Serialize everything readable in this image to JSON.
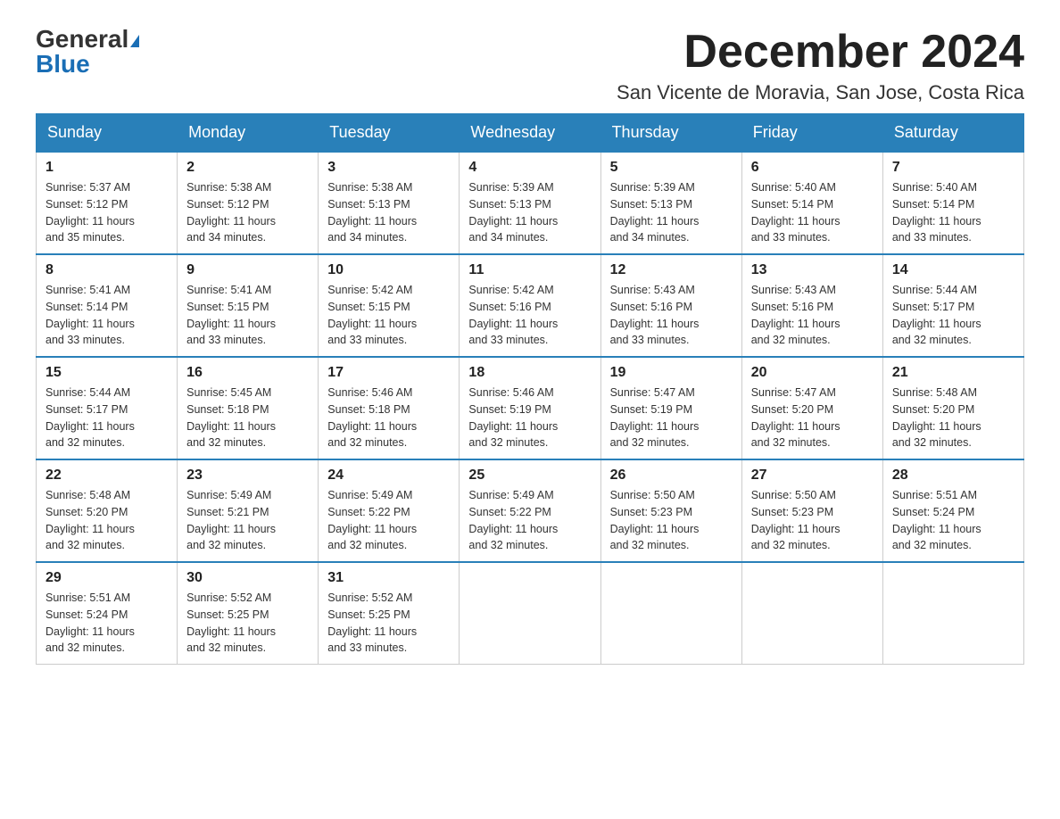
{
  "logo": {
    "general": "General",
    "blue": "Blue"
  },
  "header": {
    "month_year": "December 2024",
    "location": "San Vicente de Moravia, San Jose, Costa Rica"
  },
  "days_of_week": [
    "Sunday",
    "Monday",
    "Tuesday",
    "Wednesday",
    "Thursday",
    "Friday",
    "Saturday"
  ],
  "weeks": [
    [
      {
        "day": "1",
        "sunrise": "5:37 AM",
        "sunset": "5:12 PM",
        "daylight": "11 hours and 35 minutes."
      },
      {
        "day": "2",
        "sunrise": "5:38 AM",
        "sunset": "5:12 PM",
        "daylight": "11 hours and 34 minutes."
      },
      {
        "day": "3",
        "sunrise": "5:38 AM",
        "sunset": "5:13 PM",
        "daylight": "11 hours and 34 minutes."
      },
      {
        "day": "4",
        "sunrise": "5:39 AM",
        "sunset": "5:13 PM",
        "daylight": "11 hours and 34 minutes."
      },
      {
        "day": "5",
        "sunrise": "5:39 AM",
        "sunset": "5:13 PM",
        "daylight": "11 hours and 34 minutes."
      },
      {
        "day": "6",
        "sunrise": "5:40 AM",
        "sunset": "5:14 PM",
        "daylight": "11 hours and 33 minutes."
      },
      {
        "day": "7",
        "sunrise": "5:40 AM",
        "sunset": "5:14 PM",
        "daylight": "11 hours and 33 minutes."
      }
    ],
    [
      {
        "day": "8",
        "sunrise": "5:41 AM",
        "sunset": "5:14 PM",
        "daylight": "11 hours and 33 minutes."
      },
      {
        "day": "9",
        "sunrise": "5:41 AM",
        "sunset": "5:15 PM",
        "daylight": "11 hours and 33 minutes."
      },
      {
        "day": "10",
        "sunrise": "5:42 AM",
        "sunset": "5:15 PM",
        "daylight": "11 hours and 33 minutes."
      },
      {
        "day": "11",
        "sunrise": "5:42 AM",
        "sunset": "5:16 PM",
        "daylight": "11 hours and 33 minutes."
      },
      {
        "day": "12",
        "sunrise": "5:43 AM",
        "sunset": "5:16 PM",
        "daylight": "11 hours and 33 minutes."
      },
      {
        "day": "13",
        "sunrise": "5:43 AM",
        "sunset": "5:16 PM",
        "daylight": "11 hours and 32 minutes."
      },
      {
        "day": "14",
        "sunrise": "5:44 AM",
        "sunset": "5:17 PM",
        "daylight": "11 hours and 32 minutes."
      }
    ],
    [
      {
        "day": "15",
        "sunrise": "5:44 AM",
        "sunset": "5:17 PM",
        "daylight": "11 hours and 32 minutes."
      },
      {
        "day": "16",
        "sunrise": "5:45 AM",
        "sunset": "5:18 PM",
        "daylight": "11 hours and 32 minutes."
      },
      {
        "day": "17",
        "sunrise": "5:46 AM",
        "sunset": "5:18 PM",
        "daylight": "11 hours and 32 minutes."
      },
      {
        "day": "18",
        "sunrise": "5:46 AM",
        "sunset": "5:19 PM",
        "daylight": "11 hours and 32 minutes."
      },
      {
        "day": "19",
        "sunrise": "5:47 AM",
        "sunset": "5:19 PM",
        "daylight": "11 hours and 32 minutes."
      },
      {
        "day": "20",
        "sunrise": "5:47 AM",
        "sunset": "5:20 PM",
        "daylight": "11 hours and 32 minutes."
      },
      {
        "day": "21",
        "sunrise": "5:48 AM",
        "sunset": "5:20 PM",
        "daylight": "11 hours and 32 minutes."
      }
    ],
    [
      {
        "day": "22",
        "sunrise": "5:48 AM",
        "sunset": "5:20 PM",
        "daylight": "11 hours and 32 minutes."
      },
      {
        "day": "23",
        "sunrise": "5:49 AM",
        "sunset": "5:21 PM",
        "daylight": "11 hours and 32 minutes."
      },
      {
        "day": "24",
        "sunrise": "5:49 AM",
        "sunset": "5:22 PM",
        "daylight": "11 hours and 32 minutes."
      },
      {
        "day": "25",
        "sunrise": "5:49 AM",
        "sunset": "5:22 PM",
        "daylight": "11 hours and 32 minutes."
      },
      {
        "day": "26",
        "sunrise": "5:50 AM",
        "sunset": "5:23 PM",
        "daylight": "11 hours and 32 minutes."
      },
      {
        "day": "27",
        "sunrise": "5:50 AM",
        "sunset": "5:23 PM",
        "daylight": "11 hours and 32 minutes."
      },
      {
        "day": "28",
        "sunrise": "5:51 AM",
        "sunset": "5:24 PM",
        "daylight": "11 hours and 32 minutes."
      }
    ],
    [
      {
        "day": "29",
        "sunrise": "5:51 AM",
        "sunset": "5:24 PM",
        "daylight": "11 hours and 32 minutes."
      },
      {
        "day": "30",
        "sunrise": "5:52 AM",
        "sunset": "5:25 PM",
        "daylight": "11 hours and 32 minutes."
      },
      {
        "day": "31",
        "sunrise": "5:52 AM",
        "sunset": "5:25 PM",
        "daylight": "11 hours and 33 minutes."
      },
      null,
      null,
      null,
      null
    ]
  ],
  "labels": {
    "sunrise": "Sunrise:",
    "sunset": "Sunset:",
    "daylight": "Daylight:"
  }
}
